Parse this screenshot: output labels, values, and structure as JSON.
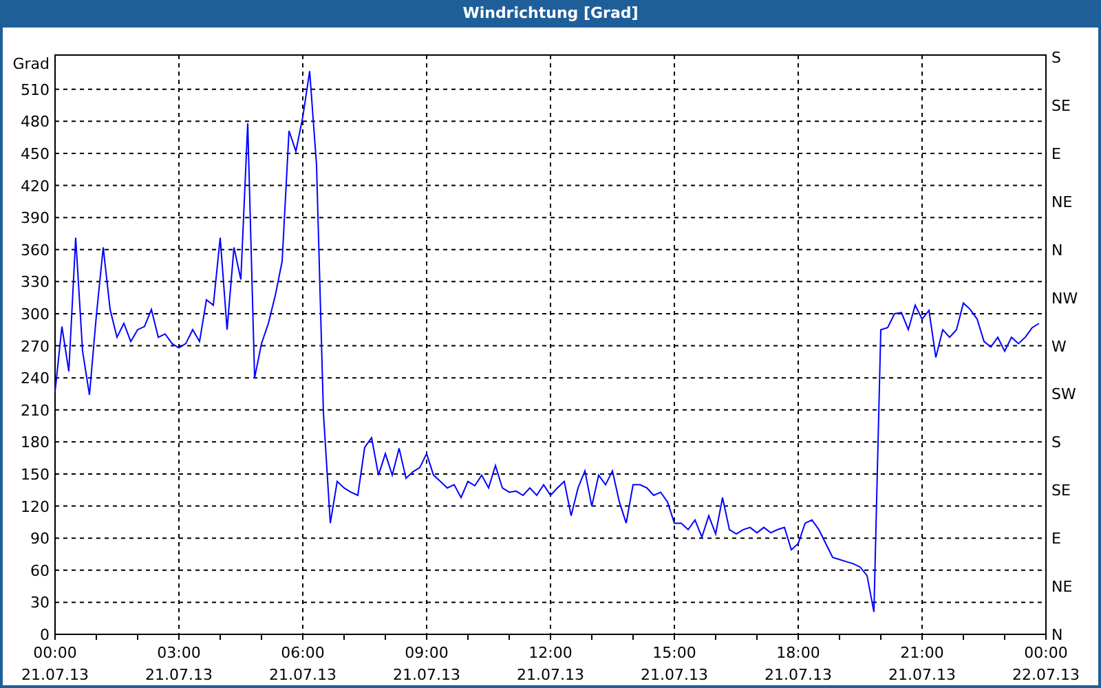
{
  "window": {
    "title": "Windrichtung [Grad]"
  },
  "chart": {
    "right_axis_labels": [
      "S",
      "SE",
      "E",
      "NE",
      "N",
      "NW",
      "W",
      "SW",
      "S",
      "SE",
      "E",
      "NE",
      "N"
    ],
    "chart_data": {
      "type": "line",
      "grid": true,
      "ylabel": "Grad",
      "ylim": [
        0,
        542
      ],
      "yticks": [
        0,
        30,
        60,
        90,
        120,
        150,
        180,
        210,
        240,
        270,
        300,
        330,
        360,
        390,
        420,
        450,
        480,
        510
      ],
      "categories": [
        "00:00\n21.07.13",
        null,
        null,
        null,
        null,
        null,
        null,
        null,
        null,
        null,
        null,
        null,
        null,
        null,
        null,
        null,
        null,
        null,
        "03:00\n21.07.13",
        null,
        null,
        null,
        null,
        null,
        null,
        null,
        null,
        null,
        null,
        null,
        null,
        null,
        null,
        null,
        null,
        null,
        "06:00\n21.07.13",
        null,
        null,
        null,
        null,
        null,
        null,
        null,
        null,
        null,
        null,
        null,
        null,
        null,
        null,
        null,
        null,
        null,
        "09:00\n21.07.13",
        null,
        null,
        null,
        null,
        null,
        null,
        null,
        null,
        null,
        null,
        null,
        null,
        null,
        null,
        null,
        null,
        null,
        "12:00\n21.07.13",
        null,
        null,
        null,
        null,
        null,
        null,
        null,
        null,
        null,
        null,
        null,
        null,
        null,
        null,
        null,
        null,
        null,
        "15:00\n21.07.13",
        null,
        null,
        null,
        null,
        null,
        null,
        null,
        null,
        null,
        null,
        null,
        null,
        null,
        null,
        null,
        null,
        null,
        "18:00\n21.07.13",
        null,
        null,
        null,
        null,
        null,
        null,
        null,
        null,
        null,
        null,
        null,
        null,
        null,
        null,
        null,
        null,
        null,
        "21:00\n21.07.13",
        null,
        null,
        null,
        null,
        null,
        null,
        null,
        null,
        null,
        null,
        null,
        null,
        null,
        null,
        null,
        null,
        null,
        "00:00\n22.07.13"
      ],
      "series": [
        {
          "color": "#0000ff",
          "values": [
            227,
            288,
            246,
            371,
            265,
            224,
            298,
            362,
            304,
            278,
            291,
            274,
            285,
            288,
            304,
            278,
            281,
            272,
            268,
            272,
            285,
            274,
            313,
            308,
            371,
            285,
            362,
            332,
            478,
            240,
            272,
            291,
            317,
            349,
            471,
            452,
            484,
            527,
            439,
            207,
            104,
            143,
            137,
            133,
            130,
            175,
            184,
            149,
            169,
            149,
            174,
            146,
            152,
            156,
            169,
            149,
            143,
            137,
            140,
            128,
            143,
            139,
            149,
            137,
            158,
            137,
            133,
            134,
            130,
            137,
            130,
            140,
            130,
            137,
            143,
            111,
            137,
            153,
            120,
            149,
            140,
            153,
            124,
            104,
            140,
            140,
            137,
            130,
            133,
            124,
            104,
            104,
            98,
            107,
            91,
            111,
            94,
            128,
            98,
            94,
            98,
            100,
            95,
            100,
            95,
            98,
            100,
            79,
            85,
            104,
            107,
            98,
            85,
            72,
            70,
            68,
            66,
            63,
            55,
            21,
            285,
            287,
            300,
            301,
            285,
            308,
            295,
            303,
            259,
            285,
            278,
            285,
            310,
            304,
            295,
            274,
            269,
            278,
            265,
            278,
            272,
            278,
            287,
            291,
            null
          ]
        }
      ]
    }
  }
}
